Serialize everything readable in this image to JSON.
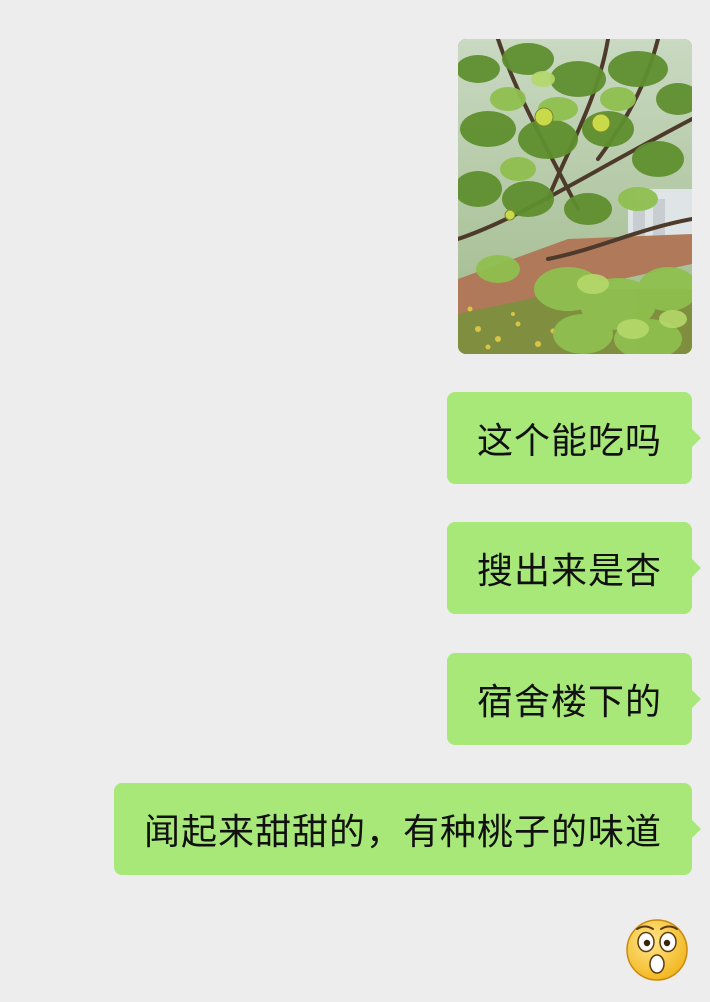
{
  "messages": [
    {
      "type": "image",
      "sender": "self",
      "icon": "photo-tree-with-apricots"
    },
    {
      "type": "text",
      "sender": "self",
      "text": "这个能吃吗"
    },
    {
      "type": "text",
      "sender": "self",
      "text": "搜出来是杏"
    },
    {
      "type": "text",
      "sender": "self",
      "text": "宿舍楼下的"
    },
    {
      "type": "text",
      "sender": "self",
      "text": "闻起来甜甜的，有种桃子的味道"
    },
    {
      "type": "emoji",
      "sender": "self",
      "icon": "astonished-face-icon"
    }
  ],
  "colors": {
    "background": "#ededed",
    "self_bubble": "#a8e879",
    "text": "#111111"
  }
}
